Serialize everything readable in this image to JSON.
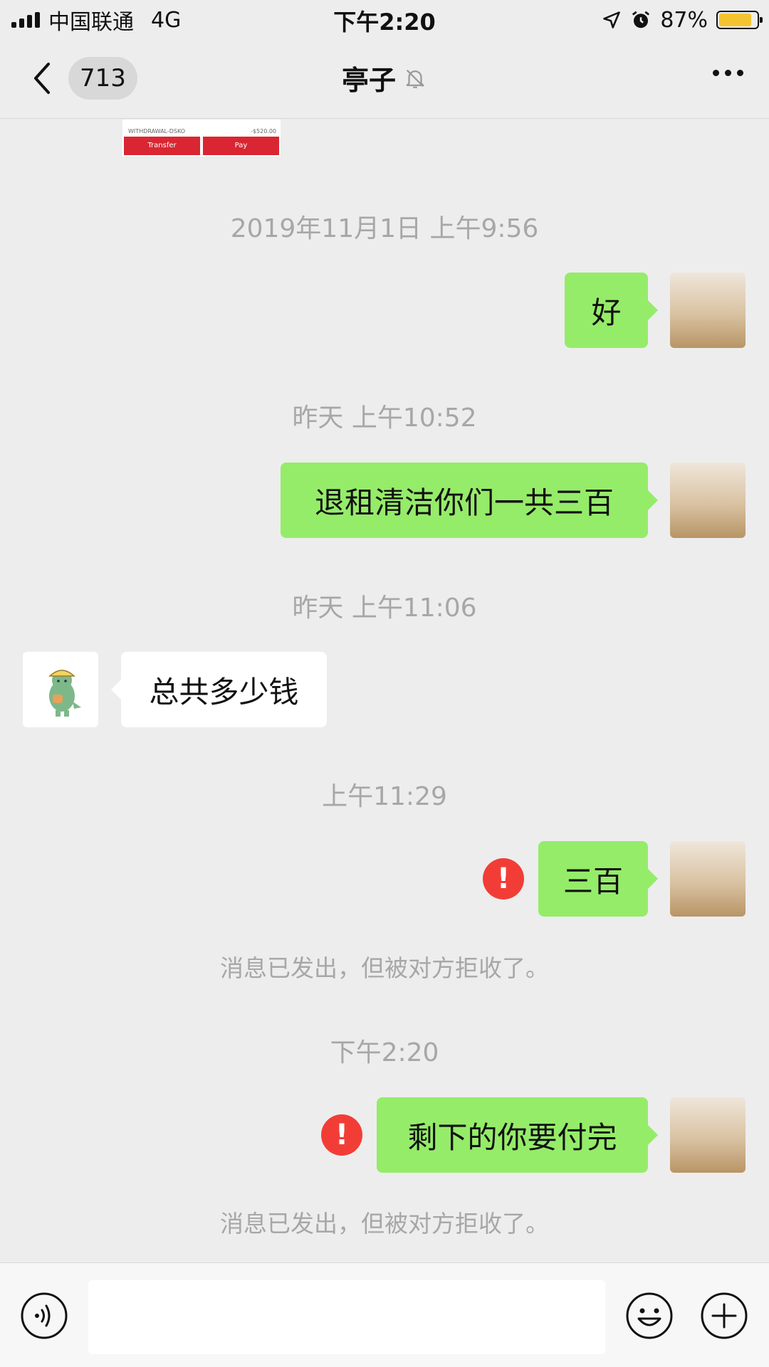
{
  "status_bar": {
    "carrier": "中国联通",
    "network": "4G",
    "time": "下午2:20",
    "battery_percent": "87%",
    "battery_level": 0.87
  },
  "nav": {
    "unread_count": "713",
    "title": "亭子"
  },
  "previous_card": {
    "row_label": "WITHDRAWAL-DSKO",
    "row_amount": "-$520.00",
    "buttons": [
      "Transfer",
      "Pay"
    ]
  },
  "messages": [
    {
      "type": "timestamp",
      "text": "2019年11月1日 上午9:56"
    },
    {
      "type": "sent",
      "text": "好",
      "failed": false
    },
    {
      "type": "timestamp",
      "text": "昨天 上午10:52"
    },
    {
      "type": "sent",
      "text": "退租清洁你们一共三百",
      "failed": false
    },
    {
      "type": "timestamp",
      "text": "昨天 上午11:06"
    },
    {
      "type": "received",
      "text": "总共多少钱"
    },
    {
      "type": "timestamp",
      "text": "上午11:29"
    },
    {
      "type": "sent",
      "text": "三百",
      "failed": true,
      "error_mark": "!"
    },
    {
      "type": "notice",
      "text": "消息已发出，但被对方拒收了。"
    },
    {
      "type": "timestamp",
      "text": "下午2:20"
    },
    {
      "type": "sent",
      "text": "剩下的你要付完",
      "failed": true,
      "error_mark": "!"
    },
    {
      "type": "notice",
      "text": "消息已发出，但被对方拒收了。"
    }
  ],
  "input": {
    "value": "",
    "placeholder": ""
  },
  "colors": {
    "sent_bubble": "#95ec69",
    "received_bubble": "#ffffff",
    "error": "#f23d37",
    "background": "#ededed"
  }
}
